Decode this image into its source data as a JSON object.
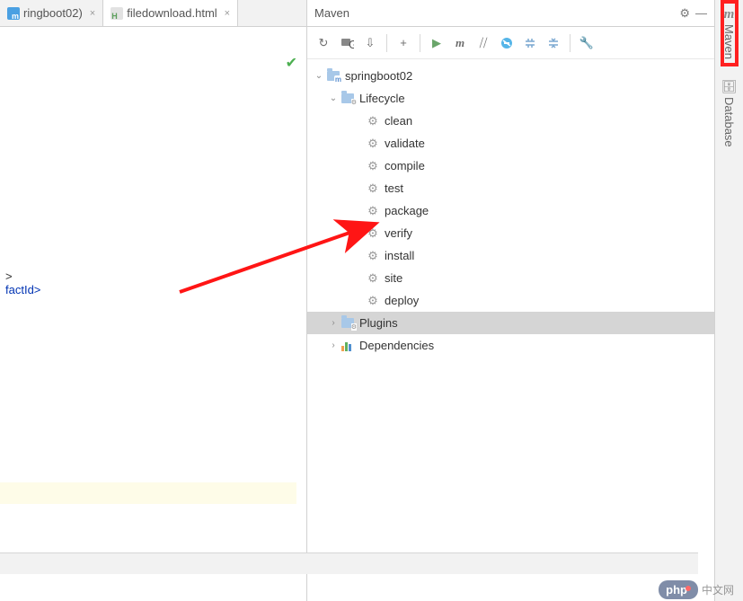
{
  "tabs": [
    {
      "label": "ringboot02)",
      "icon": "m"
    },
    {
      "label": "filedownload.html",
      "icon": "h"
    }
  ],
  "editor": {
    "line1": ">",
    "line2_close": "factId>"
  },
  "panel": {
    "title": "Maven"
  },
  "toolbar_icons": {
    "reload": "↻",
    "generate": "G",
    "download": "⇩",
    "add": "+",
    "run": "▶",
    "m": "m",
    "skip": "⧸⧸",
    "offline": "⊘",
    "expand": "⇱",
    "collapse": "⇲",
    "settings": "🔧"
  },
  "tree": {
    "root": {
      "label": "springboot02",
      "expanded": true
    },
    "lifecycle": {
      "label": "Lifecycle",
      "expanded": true
    },
    "goals": [
      "clean",
      "validate",
      "compile",
      "test",
      "package",
      "verify",
      "install",
      "site",
      "deploy"
    ],
    "plugins": {
      "label": "Plugins",
      "expanded": false,
      "selected": true
    },
    "dependencies": {
      "label": "Dependencies",
      "expanded": false
    }
  },
  "sidebar": {
    "maven": "Maven",
    "database": "Database"
  },
  "watermark": {
    "badge": "php",
    "text": "中文网"
  }
}
